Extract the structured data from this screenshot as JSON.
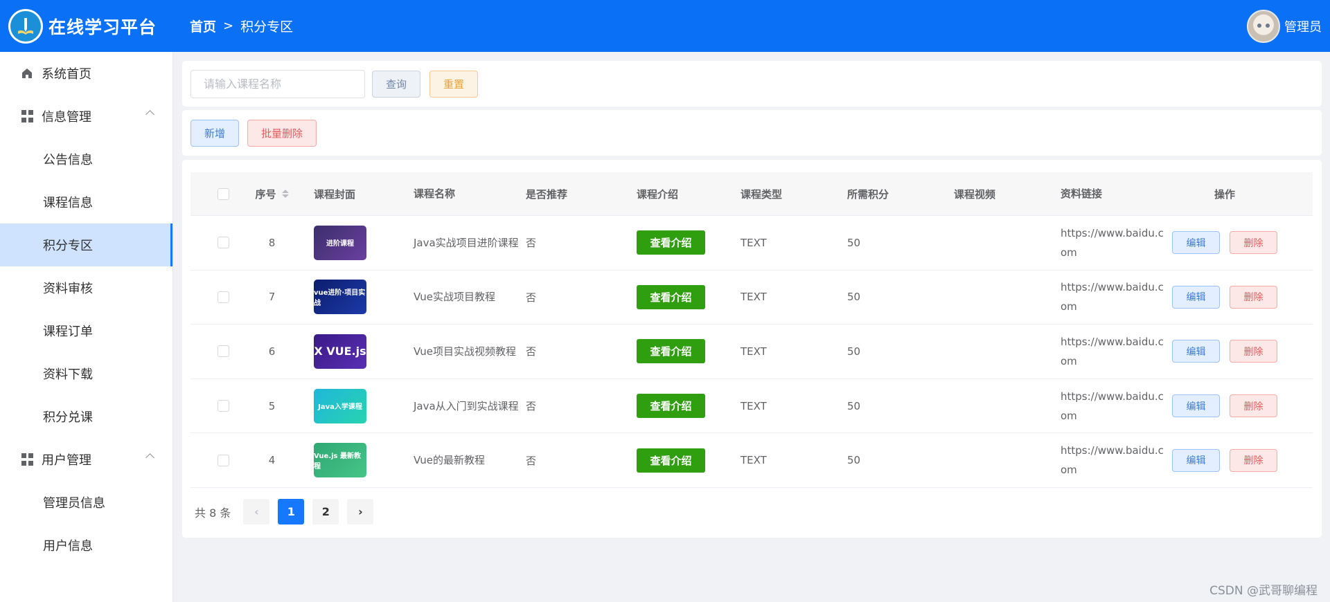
{
  "header": {
    "title": "在线学习平台",
    "breadcrumb_home": "首页",
    "breadcrumb_sep": ">",
    "breadcrumb_current": "积分专区",
    "user_name": "管理员"
  },
  "sidebar": {
    "items": [
      {
        "label": "系统首页",
        "type": "top"
      },
      {
        "label": "信息管理",
        "type": "group"
      },
      {
        "label": "公告信息",
        "type": "sub"
      },
      {
        "label": "课程信息",
        "type": "sub"
      },
      {
        "label": "积分专区",
        "type": "sub",
        "active": true
      },
      {
        "label": "资料审核",
        "type": "sub"
      },
      {
        "label": "课程订单",
        "type": "sub"
      },
      {
        "label": "资料下载",
        "type": "sub"
      },
      {
        "label": "积分兑课",
        "type": "sub"
      },
      {
        "label": "用户管理",
        "type": "group"
      },
      {
        "label": "管理员信息",
        "type": "sub"
      },
      {
        "label": "用户信息",
        "type": "sub"
      }
    ]
  },
  "search": {
    "placeholder": "请输入课程名称",
    "query_label": "查询",
    "reset_label": "重置"
  },
  "toolbar": {
    "add_label": "新增",
    "batch_delete_label": "批量删除"
  },
  "table": {
    "columns": [
      "序号",
      "课程封面",
      "课程名称",
      "是否推荐",
      "课程介绍",
      "课程类型",
      "所需积分",
      "课程视频",
      "资料链接",
      "操作"
    ],
    "rows": [
      {
        "seq": "8",
        "cover_text": "进阶课程",
        "name": "Java实战项目进阶课程",
        "recommend": "否",
        "intro_label": "查看介绍",
        "type": "TEXT",
        "points": "50",
        "video": "",
        "link": "https://www.baidu.com",
        "edit_label": "编辑",
        "delete_label": "删除"
      },
      {
        "seq": "7",
        "cover_text": "vue进阶·项目实战",
        "name": "Vue实战项目教程",
        "recommend": "否",
        "intro_label": "查看介绍",
        "type": "TEXT",
        "points": "50",
        "video": "",
        "link": "https://www.baidu.com",
        "edit_label": "编辑",
        "delete_label": "删除"
      },
      {
        "seq": "6",
        "cover_text": "X VUE.js",
        "name": "Vue项目实战视频教程",
        "recommend": "否",
        "intro_label": "查看介绍",
        "type": "TEXT",
        "points": "50",
        "video": "",
        "link": "https://www.baidu.com",
        "edit_label": "编辑",
        "delete_label": "删除"
      },
      {
        "seq": "5",
        "cover_text": "Java入学课程",
        "name": "Java从入门到实战课程",
        "recommend": "否",
        "intro_label": "查看介绍",
        "type": "TEXT",
        "points": "50",
        "video": "",
        "link": "https://www.baidu.com",
        "edit_label": "编辑",
        "delete_label": "删除"
      },
      {
        "seq": "4",
        "cover_text": "Vue.js 最新教程",
        "name": "Vue的最新教程",
        "recommend": "否",
        "intro_label": "查看介绍",
        "type": "TEXT",
        "points": "50",
        "video": "",
        "link": "https://www.baidu.com",
        "edit_label": "编辑",
        "delete_label": "删除"
      }
    ]
  },
  "pagination": {
    "total_text": "共 8 条",
    "pages": [
      "1",
      "2"
    ],
    "current": "1",
    "prev": "‹",
    "next": "›"
  },
  "watermark": "CSDN @武哥聊编程",
  "colors": {
    "header_bg": "#0a70f5",
    "active_menu_bg": "#cfe3ff",
    "intro_button": "#2f9e0f",
    "page_active": "#1677ff"
  }
}
